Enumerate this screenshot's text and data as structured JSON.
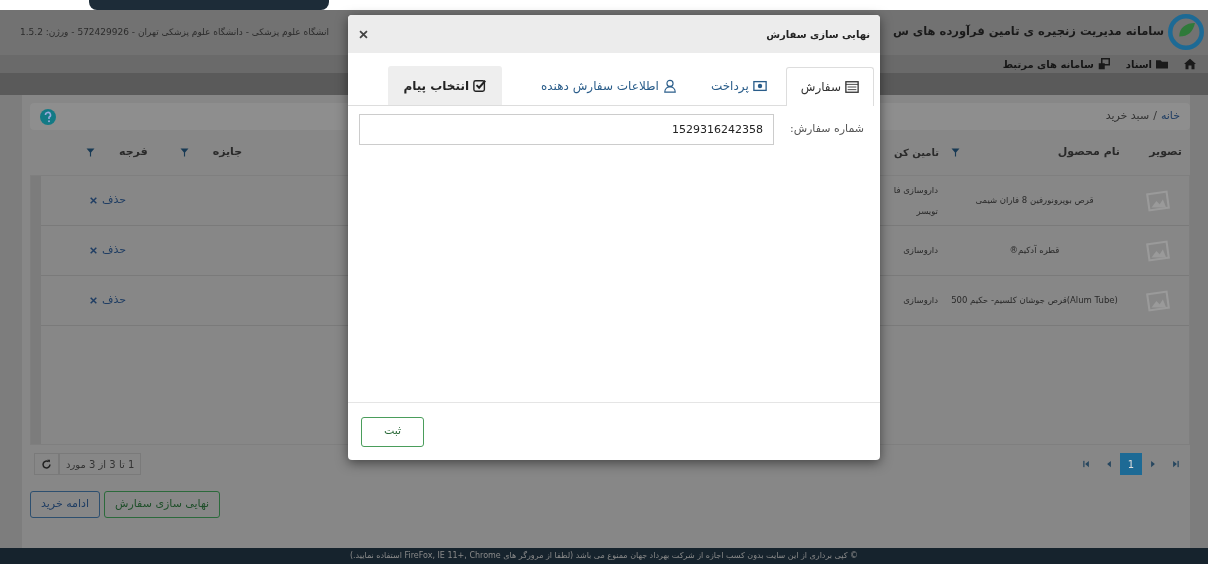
{
  "header": {
    "title": "سامانه مدیریت زنجیره ی تامین فرآورده های س",
    "subtitle": "انشگاه علوم پزشکی - دانشگاه علوم پزشکی تهران - 572429926 - ورژن: 1.5.2"
  },
  "nav": [
    {
      "kind": "home"
    },
    {
      "kind": "folder",
      "label": "اسناد"
    },
    {
      "kind": "windows",
      "label": "سامانه های مرتبط"
    }
  ],
  "breadcrumb": {
    "separator": "/",
    "items": [
      {
        "label": "خانه",
        "kind": "link"
      },
      {
        "label": "سبد خرید",
        "kind": "current"
      }
    ]
  },
  "table": {
    "columns_right": [
      {
        "label": "تصویر",
        "filter": false
      },
      {
        "label": "نام محصول",
        "filter": true
      },
      {
        "label": "تامین کن",
        "filter": false
      }
    ],
    "columns_left": [
      {
        "label": "جایزه",
        "filter": true
      },
      {
        "label": "فرجه",
        "filter": true
      }
    ],
    "rows": [
      {
        "product": "قرص بوپرونورفین 8 فاران شیمی",
        "supplier": [
          "داروسازی فا",
          "تویسر"
        ],
        "action": "حذف"
      },
      {
        "product": "قطره آدکیم®",
        "supplier": [
          "داروسازی"
        ],
        "action": "حذف"
      },
      {
        "product": "(Alum Tube)قرص جوشان کلسیم- حکیم 500",
        "supplier": [
          "داروسازی"
        ],
        "action": "حذف"
      }
    ]
  },
  "pager": {
    "summary": "1 تا 3 از 3 مورد",
    "pages": [
      {
        "label": "1",
        "selected": true
      }
    ]
  },
  "buttons": [
    {
      "label": "نهایی سازی سفارش",
      "kind": "success"
    },
    {
      "label": "ادامه خرید",
      "kind": "primary"
    }
  ],
  "footer": "© کپی برداری از این سایت بدون کسب اجازه از شرکت بهرداد جهان ممنوع می باشد (لطفا از مرورگر های FireFox, IE 11+, Chrome استفاده نمایید.)",
  "modal": {
    "title": "نهایی سازی سفارش",
    "tabs": [
      {
        "label": "سفارش",
        "selected": true,
        "hover": false
      },
      {
        "label": "پرداخت",
        "selected": false,
        "hover": false
      },
      {
        "label": "اطلاعات سفارش دهنده",
        "selected": false,
        "hover": false
      },
      {
        "label": "انتخاب پیام",
        "selected": false,
        "hover": true
      }
    ],
    "field": {
      "label": "شماره سفارش:",
      "value": "1529316242358"
    },
    "submit": "ثبت"
  }
}
